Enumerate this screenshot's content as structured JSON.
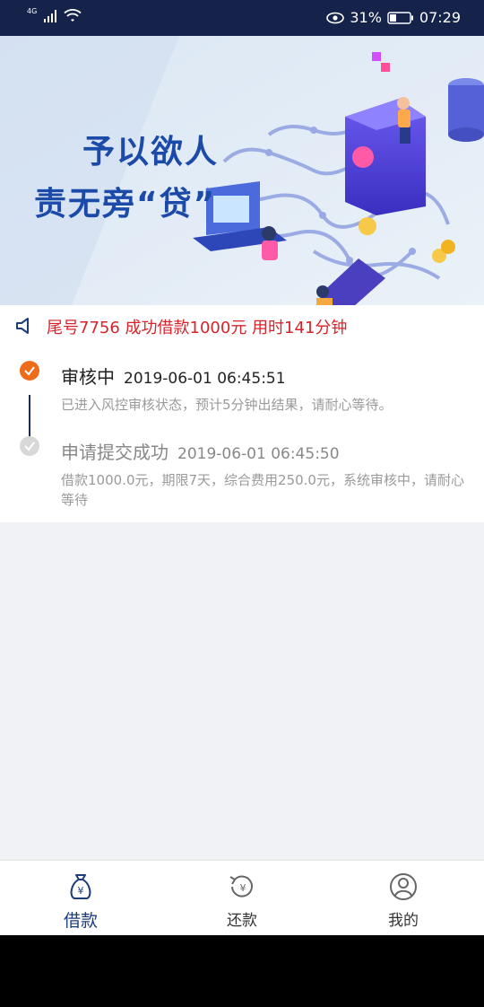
{
  "statusbar": {
    "network": "4G",
    "battery_percent": "31%",
    "time": "07:29"
  },
  "banner": {
    "title_line1": "予以欲人",
    "title_line2": "责无旁“贷”",
    "active_slide": 1
  },
  "notice": {
    "text": "尾号7756 成功借款1000元 用时141分钟"
  },
  "timeline": {
    "items": [
      {
        "title": "审核中",
        "time": "2019-06-01 06:45:51",
        "desc": "已进入风控审核状态，预计5分钟出结果，请耐心等待。",
        "status": "active"
      },
      {
        "title": "申请提交成功",
        "time": "2019-06-01 06:45:50",
        "desc": "借款1000.0元，期限7天，综合费用250.0元，系统审核中，请耐心等待",
        "status": "done"
      }
    ]
  },
  "bottomnav": {
    "items": [
      {
        "label": "借款",
        "icon": "money-bag-icon",
        "active": true
      },
      {
        "label": "还款",
        "icon": "repay-icon",
        "active": false
      },
      {
        "label": "我的",
        "icon": "user-icon",
        "active": false
      }
    ]
  },
  "colors": {
    "statusbar_bg": "#15234a",
    "notice_red": "#d8232a",
    "timeline_active": "#ec6c1a",
    "nav_active": "#1d3d7a"
  }
}
